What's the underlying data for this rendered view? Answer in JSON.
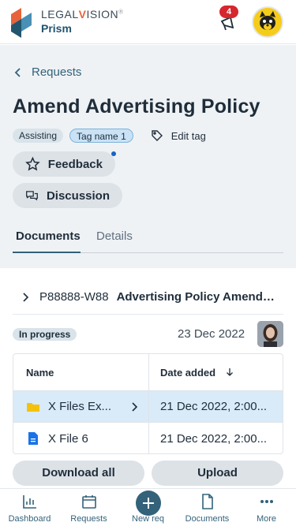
{
  "header": {
    "logo_part1": "LEGAL",
    "logo_part2": "V",
    "logo_part3": "ISION",
    "logo_reg": "®",
    "logo_sub": "Prism",
    "notification_count": "4",
    "bell_icon": "megaphone-icon",
    "avatar_icon": "raccoon-avatar"
  },
  "breadcrumb": {
    "back_icon": "chevron-left-icon",
    "label": "Requests"
  },
  "request": {
    "title": "Amend Advertising Policy",
    "tags": [
      "Assisting",
      "Tag name 1"
    ],
    "edit_tag_label": "Edit tag",
    "feedback_label": "Feedback",
    "discussion_label": "Discussion"
  },
  "tabs": [
    {
      "label": "Documents",
      "active": true
    },
    {
      "label": "Details",
      "active": false
    }
  ],
  "case": {
    "id": "P88888-W88",
    "name": "Advertising Policy Amendme..."
  },
  "status": {
    "badge": "In progress",
    "date": "23 Dec 2022"
  },
  "table": {
    "headers": [
      "Name",
      "Date added"
    ],
    "rows": [
      {
        "icon": "folder-icon",
        "name": "X Files Ex...",
        "date": "21 Dec 2022, 2:00...",
        "selected": true
      },
      {
        "icon": "document-icon",
        "name": "X File 6",
        "date": "21 Dec 2022, 2:00...",
        "selected": false
      }
    ]
  },
  "actions": {
    "download_label": "Download all",
    "upload_label": "Upload"
  },
  "nav": [
    {
      "label": "Dashboard",
      "icon": "chart-icon"
    },
    {
      "label": "Requests",
      "icon": "calendar-icon"
    },
    {
      "label": "New req",
      "icon": "plus-icon"
    },
    {
      "label": "Documents",
      "icon": "document-icon"
    },
    {
      "label": "More",
      "icon": "dots-icon"
    }
  ],
  "colors": {
    "accent": "#33627a",
    "badge_red": "#d6262e",
    "selected_row": "#d9ebf8",
    "summary_bg": "#eff2f5"
  }
}
